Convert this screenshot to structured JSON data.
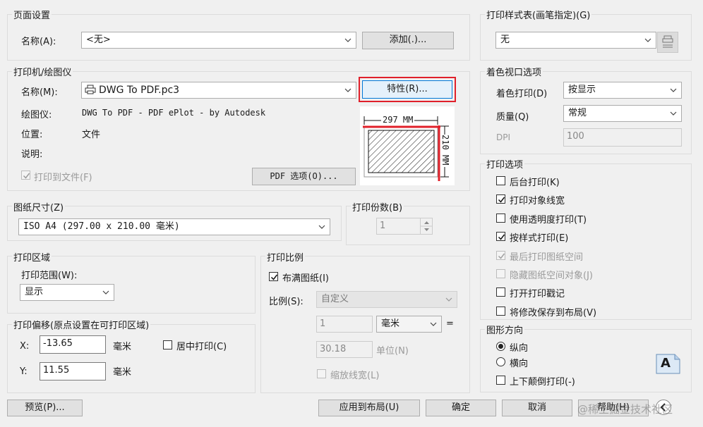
{
  "page_setup": {
    "title": "页面设置",
    "name_label": "名称(A):",
    "name_value": "<无>",
    "add_button": "添加(.)..."
  },
  "printer": {
    "title": "打印机/绘图仪",
    "name_label": "名称(M):",
    "name_value": "DWG To PDF.pc3",
    "properties_button": "特性(R)...",
    "plotter_label": "绘图仪:",
    "plotter_value": "DWG To PDF - PDF ePlot - by Autodesk",
    "location_label": "位置:",
    "location_value": "文件",
    "description_label": "说明:",
    "plot_to_file_label": "打印到文件(F)",
    "pdf_options_button": "PDF 选项(O)...",
    "preview_width": "297 MM",
    "preview_height": "210 MM"
  },
  "paper_size": {
    "title": "图纸尺寸(Z)",
    "value": "ISO A4 (297.00 x 210.00 毫米)"
  },
  "copies": {
    "title": "打印份数(B)",
    "value": "1"
  },
  "plot_area": {
    "title": "打印区域",
    "range_label": "打印范围(W):",
    "range_value": "显示"
  },
  "plot_offset": {
    "title": "打印偏移(原点设置在可打印区域)",
    "x_label": "X:",
    "x_value": "-13.65",
    "x_unit": "毫米",
    "y_label": "Y:",
    "y_value": "11.55",
    "y_unit": "毫米",
    "center_label": "居中打印(C)"
  },
  "plot_scale": {
    "title": "打印比例",
    "fit_label": "布满图纸(I)",
    "scale_label": "比例(S):",
    "scale_value": "自定义",
    "value1": "1",
    "unit_value": "毫米",
    "equals": "=",
    "value2": "30.18",
    "unit2": "单位(N)",
    "lineweights_label": "缩放线宽(L)"
  },
  "plot_style": {
    "title": "打印样式表(画笔指定)(G)",
    "value": "无"
  },
  "shaded": {
    "title": "着色视口选项",
    "shade_label": "着色打印(D)",
    "shade_value": "按显示",
    "quality_label": "质量(Q)",
    "quality_value": "常规",
    "dpi_label": "DPI",
    "dpi_value": "100"
  },
  "plot_options": {
    "title": "打印选项",
    "items": [
      {
        "label": "后台打印(K)",
        "checked": false,
        "disabled": false
      },
      {
        "label": "打印对象线宽",
        "checked": true,
        "disabled": false
      },
      {
        "label": "使用透明度打印(T)",
        "checked": false,
        "disabled": false
      },
      {
        "label": "按样式打印(E)",
        "checked": true,
        "disabled": false
      },
      {
        "label": "最后打印图纸空间",
        "checked": true,
        "disabled": true
      },
      {
        "label": "隐藏图纸空间对象(J)",
        "checked": false,
        "disabled": true
      },
      {
        "label": "打开打印戳记",
        "checked": false,
        "disabled": false
      },
      {
        "label": "将修改保存到布局(V)",
        "checked": false,
        "disabled": false
      }
    ]
  },
  "orientation": {
    "title": "图形方向",
    "portrait": "纵向",
    "landscape": "横向",
    "upside_down": "上下颠倒打印(-)",
    "icon_letter": "A"
  },
  "footer": {
    "preview": "预览(P)...",
    "apply": "应用到布局(U)",
    "ok": "确定",
    "cancel": "取消",
    "help": "帮助(H)"
  },
  "watermark": "@稀土掘金技术社区",
  "colors": {
    "highlight": "#e0202a",
    "focus": "#0078d7"
  }
}
